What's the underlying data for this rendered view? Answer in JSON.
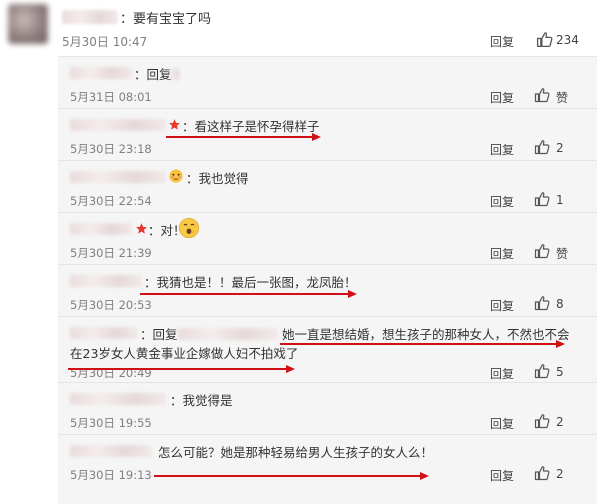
{
  "top_comment": {
    "text": "：要有宝宝了吗",
    "time": "5月30日 10:47",
    "reply_label": "回复",
    "like_count": "234"
  },
  "replies": [
    {
      "prefix": "：回复",
      "text": "",
      "time": "5月31日 08:01",
      "reply_label": "回复",
      "like_label": "赞"
    },
    {
      "text": "：看这样子是怀孕得样子",
      "time": "5月30日 23:18",
      "reply_label": "回复",
      "like_label": "2"
    },
    {
      "text": "：我也觉得",
      "time": "5月30日 22:54",
      "reply_label": "回复",
      "like_label": "1"
    },
    {
      "text": "：对！",
      "time": "5月30日 21:39",
      "reply_label": "回复",
      "like_label": "赞"
    },
    {
      "text": "：我猜也是！！最后一张图，龙凤胎！",
      "time": "5月30日 20:53",
      "reply_label": "回复",
      "like_label": "8"
    },
    {
      "prefix": "：回复",
      "text": "她一直是想结婚，想生孩子的那种女人，不然也不会",
      "text2": "在23岁女人黄金事业企嫁做人妇不拍戏了",
      "time": "5月30日 20:49",
      "reply_label": "回复",
      "like_label": "5"
    },
    {
      "text": "：我觉得是",
      "time": "5月30日 19:55",
      "reply_label": "回复",
      "like_label": "2"
    },
    {
      "text": "怎么可能？她是那种轻易给男人生孩子的女人么！",
      "time": "5月30日 19:13",
      "reply_label": "回复",
      "like_label": "2"
    }
  ],
  "colors": {
    "annotation_red": "#d10f17",
    "panel_bg": "#f5f5f5",
    "time_gray": "#808080"
  },
  "icons": {
    "like": "thumbs-up-icon",
    "badge": "red-star-icon",
    "emoji_blush": "blush-emoji-icon",
    "emoji_surprise": "surprised-emoji-icon"
  }
}
